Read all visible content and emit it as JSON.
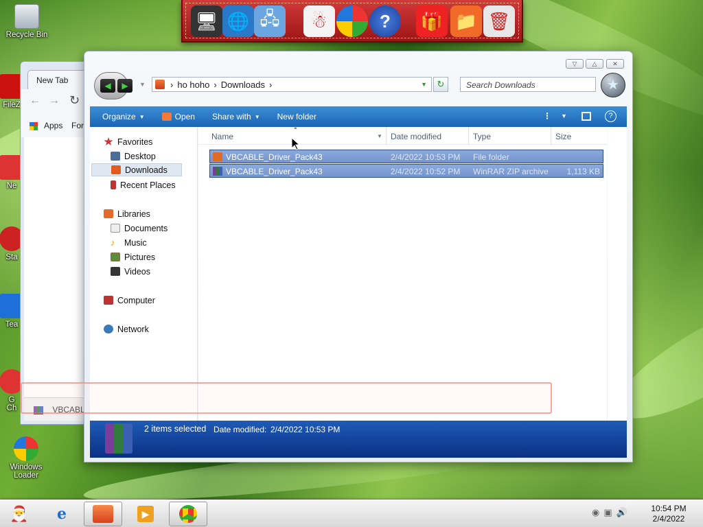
{
  "desktop": {
    "icons": [
      {
        "label": "Recycle Bin"
      },
      {
        "label": "FileZ"
      },
      {
        "label": "Ne"
      },
      {
        "label": "Sta"
      },
      {
        "label": "Tea"
      },
      {
        "label": "G\nCh"
      },
      {
        "label": "Windows Loader"
      }
    ]
  },
  "dock": {
    "items": [
      "monitor-icon",
      "globe-icon",
      "network-icon",
      "snowman-icon",
      "shield-icon",
      "help-icon",
      "gift-icon",
      "folder-icon",
      "trash-icon"
    ]
  },
  "chrome": {
    "tab_title": "New Tab",
    "apps_label": "Apps",
    "bookmark_partial": "For",
    "download_item": "VBCABLE"
  },
  "explorer": {
    "address": {
      "crumbs": [
        "ho hoho",
        "Downloads"
      ]
    },
    "search_placeholder": "Search Downloads",
    "commands": {
      "organize": "Organize",
      "open": "Open",
      "share_with": "Share with",
      "new_folder": "New folder"
    },
    "nav": {
      "favorites": "Favorites",
      "desktop": "Desktop",
      "downloads": "Downloads",
      "recent_places": "Recent Places",
      "libraries": "Libraries",
      "documents": "Documents",
      "music": "Music",
      "pictures": "Pictures",
      "videos": "Videos",
      "computer": "Computer",
      "network": "Network"
    },
    "columns": {
      "name": "Name",
      "date_modified": "Date modified",
      "type": "Type",
      "size": "Size"
    },
    "files": [
      {
        "name": "VBCABLE_Driver_Pack43",
        "date": "2/4/2022 10:53 PM",
        "type": "File folder",
        "size": ""
      },
      {
        "name": "VBCABLE_Driver_Pack43",
        "date": "2/4/2022 10:52 PM",
        "type": "WinRAR ZIP archive",
        "size": "1,113 KB"
      }
    ],
    "details": {
      "count": "2 items selected",
      "date_label": "Date modified:",
      "date_value": "2/4/2022 10:53 PM"
    }
  },
  "taskbar": {
    "time": "10:54 PM",
    "date": "2/4/2022"
  }
}
